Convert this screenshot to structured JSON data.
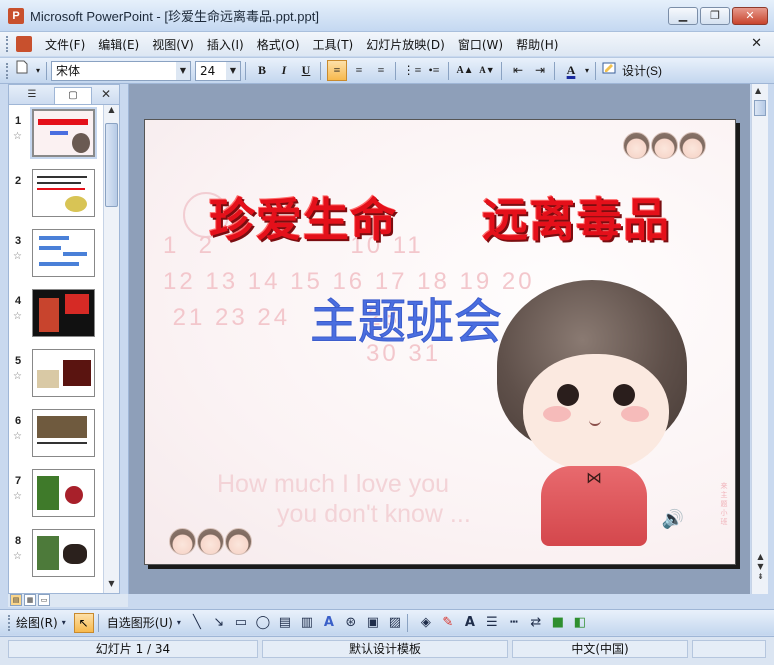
{
  "window": {
    "app_icon": "powerpoint-icon",
    "title": "Microsoft PowerPoint - [珍爱生命远离毒品.ppt.ppt]",
    "minimize": "▁",
    "restore": "❐",
    "close": "✕"
  },
  "menu": {
    "items": [
      "文件(F)",
      "编辑(E)",
      "视图(V)",
      "插入(I)",
      "格式(O)",
      "工具(T)",
      "幻灯片放映(D)",
      "窗口(W)",
      "帮助(H)"
    ],
    "close_doc": "✕"
  },
  "format_toolbar": {
    "font_name": "宋体",
    "font_size": "24",
    "bold": "B",
    "italic": "I",
    "underline": "U",
    "align_left": "≡",
    "align_center": "≡",
    "align_right": "≡",
    "numbering": "⋮≡",
    "bullets": "•≡",
    "grow_font": "A▲",
    "shrink_font": "A▼",
    "decrease_indent": "⇤",
    "increase_indent": "⇥",
    "font_color": "A",
    "design_label": "设计(S)",
    "accent_color": "#f7b94d"
  },
  "panel": {
    "tab_outline_icon": "outline-icon",
    "tab_slides_icon": "slides-icon",
    "close": "✕",
    "slides": [
      {
        "num": "1",
        "star": "☆"
      },
      {
        "num": "2",
        "star": ""
      },
      {
        "num": "3",
        "star": "☆"
      },
      {
        "num": "4",
        "star": "☆"
      },
      {
        "num": "5",
        "star": "☆"
      },
      {
        "num": "6",
        "star": "☆"
      },
      {
        "num": "7",
        "star": "☆"
      },
      {
        "num": "8",
        "star": "☆"
      }
    ]
  },
  "slide": {
    "title": "珍爱生命     远离毒品",
    "subtitle": "主题班会",
    "calendar_digits": "1  2              10 11\n12 13 14 15 16 17 18 19 20\n 21 23 24        28\n                     30 31",
    "ghost_line1": "How much I love you",
    "ghost_line2": "you don't know ...",
    "side_text": "来 主 题 小 班",
    "speaker_icon": "🔊"
  },
  "drawing_toolbar": {
    "draw_label": "绘图(R)",
    "autoshapes_label": "自选图形(U)",
    "icons": [
      "line-icon",
      "arrow-icon",
      "rectangle-icon",
      "oval-icon",
      "textbox-icon",
      "vertical-textbox-icon",
      "wordart-icon",
      "diagram-icon",
      "clipart-icon",
      "picture-icon",
      "fill-color-icon",
      "line-color-icon",
      "font-color-icon",
      "line-style-icon",
      "dash-style-icon",
      "arrow-style-icon",
      "shadow-icon",
      "3d-icon"
    ]
  },
  "statusbar": {
    "slide_info": "幻灯片 1 / 34",
    "template": "默认设计模板",
    "language": "中文(中国)"
  }
}
